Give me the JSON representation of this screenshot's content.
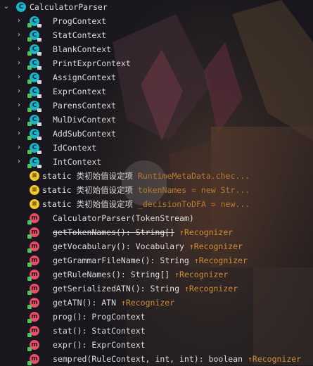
{
  "root": {
    "name": "CalculatorParser"
  },
  "classes": [
    "ProgContext",
    "StatContext",
    "BlankContext",
    "PrintExprContext",
    "AssignContext",
    "ExprContext",
    "ParensContext",
    "MulDivContext",
    "AddSubContext",
    "IdContext",
    "IntContext"
  ],
  "fields": [
    {
      "modifier": "static",
      "name": "类初始值设定项",
      "hint": "RuntimeMetaData.chec..."
    },
    {
      "modifier": "static",
      "name": "类初始值设定项",
      "hint": "tokenNames = new Str..."
    },
    {
      "modifier": "static",
      "name": "类初始值设定项",
      "hint": "_decisionToDFA = new..."
    }
  ],
  "methods": [
    {
      "sig": "CalculatorParser(TokenStream)",
      "hint": ""
    },
    {
      "sig": "getTokenNames(): String[]",
      "hint": "↑Recognizer",
      "deprecated": true
    },
    {
      "sig": "getVocabulary(): Vocabulary",
      "hint": "↑Recognizer"
    },
    {
      "sig": "getGrammarFileName(): String",
      "hint": "↑Recognizer"
    },
    {
      "sig": "getRuleNames(): String[]",
      "hint": "↑Recognizer"
    },
    {
      "sig": "getSerializedATN(): String",
      "hint": "↑Recognizer"
    },
    {
      "sig": "getATN(): ATN",
      "hint": "↑Recognizer"
    },
    {
      "sig": "prog(): ProgContext",
      "hint": ""
    },
    {
      "sig": "stat(): StatContext",
      "hint": ""
    },
    {
      "sig": "expr(): ExprContext",
      "hint": ""
    },
    {
      "sig": "sempred(RuleContext, int, int): boolean",
      "hint": "↑Recognizer"
    }
  ],
  "icons": {
    "class": "class-icon",
    "method": "method-icon",
    "field": "static-field-icon",
    "expand": "chevron-right-icon",
    "collapse": "chevron-down-icon"
  },
  "colors": {
    "class_icon": "#1fb1c9",
    "method_icon": "#e5506b",
    "field_icon": "#f3c731",
    "hint": "#cf8e3a",
    "text": "#dcdcdc"
  }
}
